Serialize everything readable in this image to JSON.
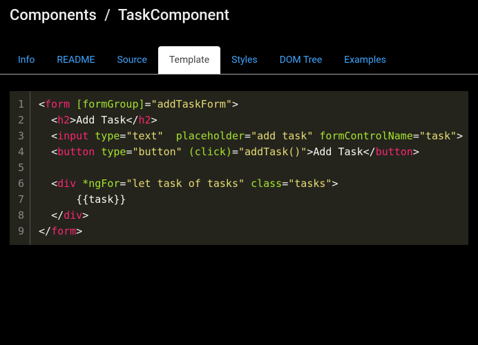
{
  "breadcrumb": {
    "root": "Components",
    "sep": "/",
    "current": "TaskComponent"
  },
  "tabs": [
    {
      "label": "Info"
    },
    {
      "label": "README"
    },
    {
      "label": "Source"
    },
    {
      "label": "Template",
      "active": true
    },
    {
      "label": "Styles"
    },
    {
      "label": "DOM Tree"
    },
    {
      "label": "Examples"
    }
  ],
  "code_lines": [
    {
      "n": "1",
      "tokens": [
        {
          "t": "<",
          "c": "tagp"
        },
        {
          "t": "form",
          "c": "tagn"
        },
        {
          "t": " ",
          "c": "txt"
        },
        {
          "t": "[formGroup]",
          "c": "attr"
        },
        {
          "t": "=",
          "c": "op"
        },
        {
          "t": "\"addTaskForm\"",
          "c": "str"
        },
        {
          "t": ">",
          "c": "tagp"
        }
      ]
    },
    {
      "n": "2",
      "indent": 2,
      "tokens": [
        {
          "t": "<",
          "c": "tagp"
        },
        {
          "t": "h2",
          "c": "tagn"
        },
        {
          "t": ">",
          "c": "tagp"
        },
        {
          "t": "Add Task",
          "c": "txt"
        },
        {
          "t": "</",
          "c": "tagp"
        },
        {
          "t": "h2",
          "c": "tagn"
        },
        {
          "t": ">",
          "c": "tagp"
        }
      ]
    },
    {
      "n": "3",
      "indent": 2,
      "tokens": [
        {
          "t": "<",
          "c": "tagp"
        },
        {
          "t": "input",
          "c": "tagn"
        },
        {
          "t": " ",
          "c": "txt"
        },
        {
          "t": "type",
          "c": "attr"
        },
        {
          "t": "=",
          "c": "op"
        },
        {
          "t": "\"text\"",
          "c": "str"
        },
        {
          "t": "  ",
          "c": "txt"
        },
        {
          "t": "placeholder",
          "c": "attr"
        },
        {
          "t": "=",
          "c": "op"
        },
        {
          "t": "\"add task\"",
          "c": "str"
        },
        {
          "t": " ",
          "c": "txt"
        },
        {
          "t": "formControlName",
          "c": "attr"
        },
        {
          "t": "=",
          "c": "op"
        },
        {
          "t": "\"task\"",
          "c": "str"
        },
        {
          "t": ">",
          "c": "tagp"
        }
      ]
    },
    {
      "n": "4",
      "indent": 2,
      "tokens": [
        {
          "t": "<",
          "c": "tagp"
        },
        {
          "t": "button",
          "c": "tagn"
        },
        {
          "t": " ",
          "c": "txt"
        },
        {
          "t": "type",
          "c": "attr"
        },
        {
          "t": "=",
          "c": "op"
        },
        {
          "t": "\"button\"",
          "c": "str"
        },
        {
          "t": " ",
          "c": "txt"
        },
        {
          "t": "(click)",
          "c": "attr"
        },
        {
          "t": "=",
          "c": "op"
        },
        {
          "t": "\"addTask()\"",
          "c": "str"
        },
        {
          "t": ">",
          "c": "tagp"
        },
        {
          "t": "Add Task",
          "c": "txt"
        },
        {
          "t": "</",
          "c": "tagp"
        },
        {
          "t": "button",
          "c": "tagn"
        },
        {
          "t": ">",
          "c": "tagp"
        }
      ]
    },
    {
      "n": "5",
      "tokens": []
    },
    {
      "n": "6",
      "indent": 2,
      "tokens": [
        {
          "t": "<",
          "c": "tagp"
        },
        {
          "t": "div",
          "c": "tagn"
        },
        {
          "t": " ",
          "c": "txt"
        },
        {
          "t": "*ngFor",
          "c": "attr"
        },
        {
          "t": "=",
          "c": "op"
        },
        {
          "t": "\"let task of tasks\"",
          "c": "str"
        },
        {
          "t": " ",
          "c": "txt"
        },
        {
          "t": "class",
          "c": "attr"
        },
        {
          "t": "=",
          "c": "op"
        },
        {
          "t": "\"tasks\"",
          "c": "str"
        },
        {
          "t": ">",
          "c": "tagp"
        }
      ]
    },
    {
      "n": "7",
      "indent": 6,
      "tokens": [
        {
          "t": "{{task}}",
          "c": "txt"
        }
      ]
    },
    {
      "n": "8",
      "indent": 2,
      "tokens": [
        {
          "t": "</",
          "c": "tagp"
        },
        {
          "t": "div",
          "c": "tagn"
        },
        {
          "t": ">",
          "c": "tagp"
        }
      ]
    },
    {
      "n": "9",
      "tokens": [
        {
          "t": "</",
          "c": "tagp"
        },
        {
          "t": "form",
          "c": "tagn"
        },
        {
          "t": ">",
          "c": "tagp"
        }
      ]
    }
  ]
}
